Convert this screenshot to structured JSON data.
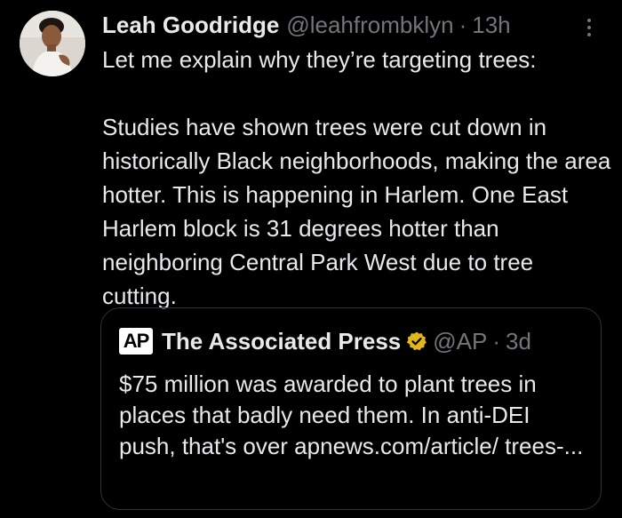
{
  "tweet": {
    "author": {
      "display_name": "Leah Goodridge",
      "handle": "@leahfrombklyn",
      "separator": "·",
      "time": "13h",
      "avatar_icon": "profile-photo"
    },
    "more_icon": "more-vertical-icon",
    "body": {
      "line1": "Let me explain why they’re targeting trees:",
      "paragraph2": "Studies have shown trees were cut down in historically Black neighborhoods, making the area hotter. This is happening in Harlem. One East Harlem block is 31 degrees hotter than neighboring Central Park West due to tree cutting."
    },
    "quote": {
      "logo_text": "AP",
      "name": "The Associated Press",
      "verified_icon": "gold-verified-badge-icon",
      "verified_color": "#e2b719",
      "handle": "@AP",
      "separator": "·",
      "time": "3d",
      "text": "$75 million was awarded to plant trees in places that badly need them. In anti-DEI push, that's over apnews.com/article/ trees-..."
    }
  },
  "colors": {
    "background": "#000000",
    "primary_text": "#e7e9ea",
    "secondary_text": "#71767b",
    "border": "#2f3336"
  }
}
